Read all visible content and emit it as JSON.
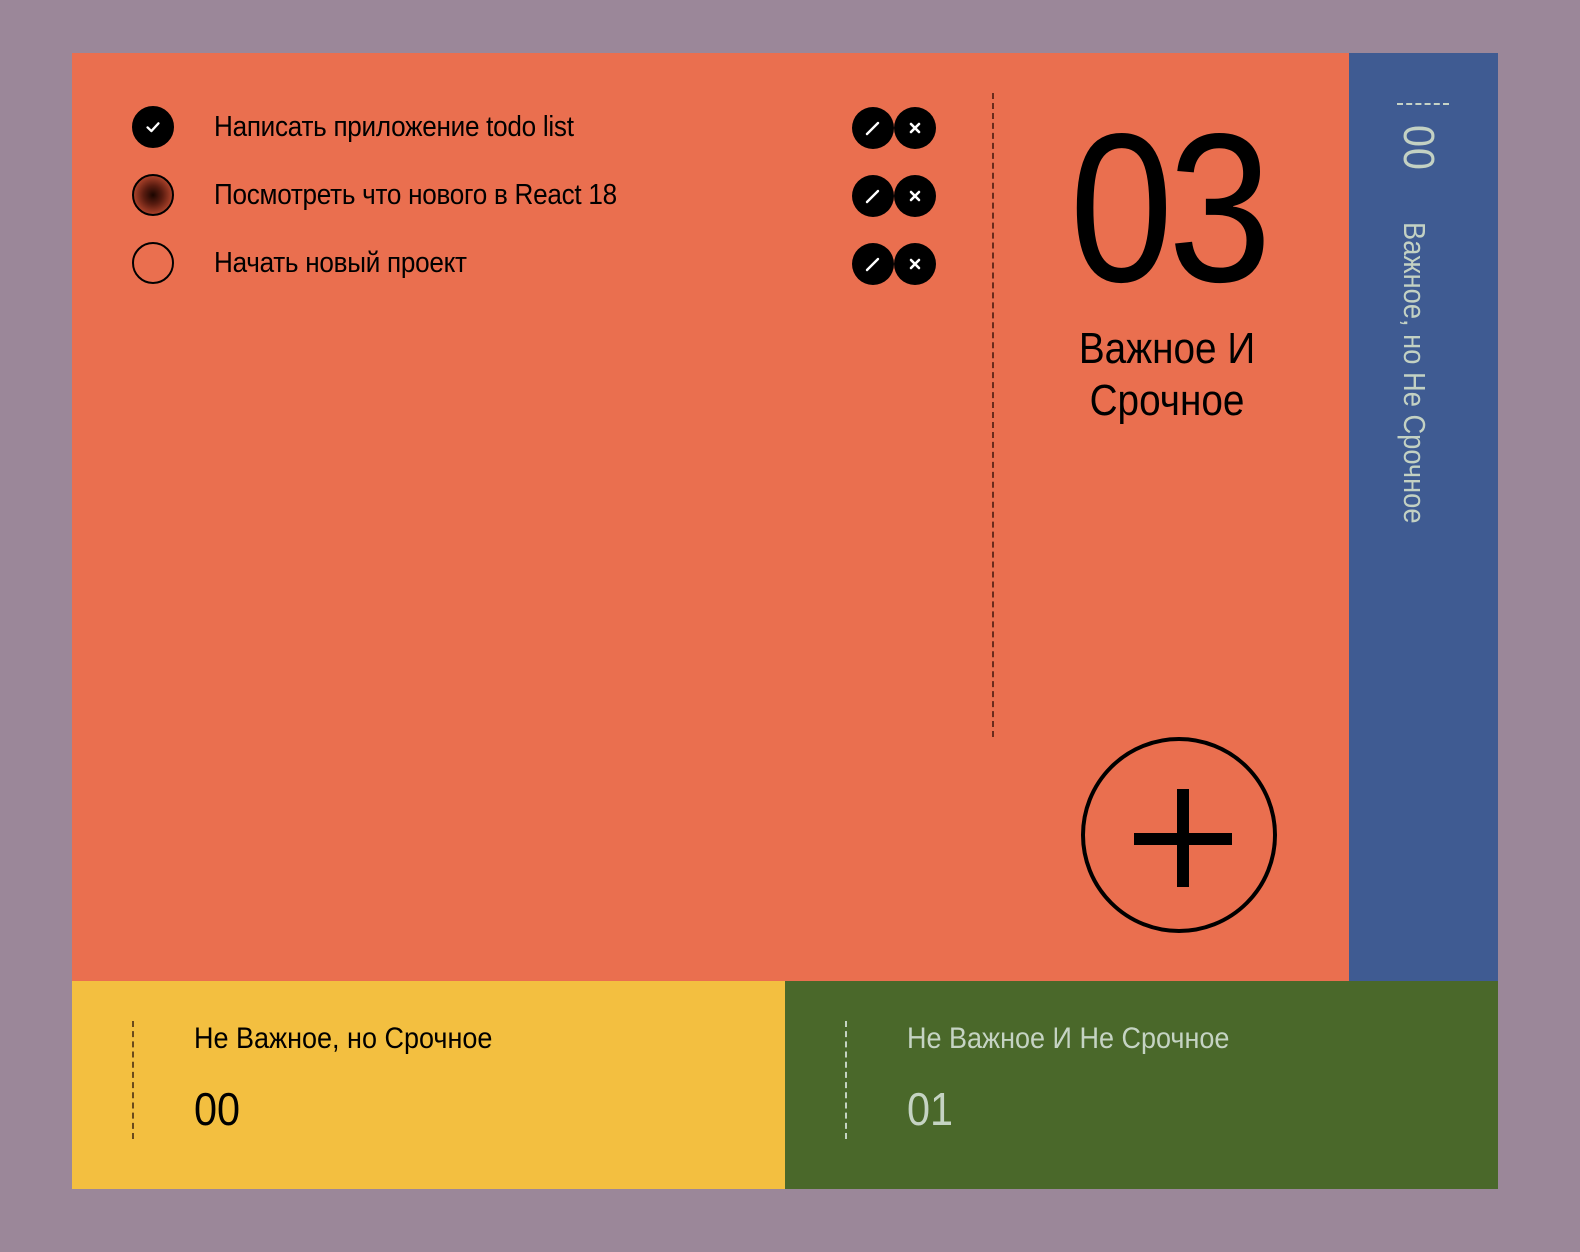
{
  "colors": {
    "background": "#9b8799",
    "urgent_important": "#ea6f4f",
    "important_not_urgent": "#3f5b92",
    "not_important_urgent": "#f3bf40",
    "not_important_not_urgent": "#4a682a"
  },
  "main_quadrant": {
    "title": "Важное И Срочное",
    "count": "03",
    "tasks": [
      {
        "text": "Написать приложение todo list",
        "status": "done",
        "edit_icon": "pencil-icon",
        "delete_icon": "close-icon"
      },
      {
        "text": "Посмотреть что нового в React 18",
        "status": "in-progress",
        "edit_icon": "pencil-icon",
        "delete_icon": "close-icon"
      },
      {
        "text": "Начать новый проект",
        "status": "todo",
        "edit_icon": "pencil-icon",
        "delete_icon": "close-icon"
      }
    ],
    "add_icon": "plus-icon"
  },
  "side_quadrant": {
    "title": "Важное, но Не Срочное",
    "count": "00"
  },
  "bottom_quadrants": [
    {
      "title": "Не Важное, но Срочное",
      "count": "00"
    },
    {
      "title": "Не Важное И Не Срочное",
      "count": "01"
    }
  ]
}
